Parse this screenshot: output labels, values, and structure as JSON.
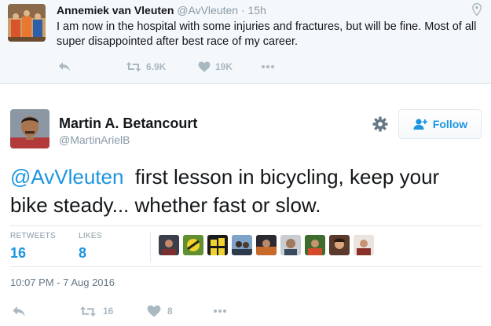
{
  "parent_tweet": {
    "name": "Annemiek van Vleuten",
    "handle": "@AvVleuten",
    "separator": "·",
    "time": "15h",
    "text": "I am now in the hospital with some injuries and fractures, but will be fine. Most of all super disappointed after best race of my career.",
    "retweets": "6.9K",
    "likes": "19K",
    "icons": [
      "reply-icon",
      "retweet-icon",
      "heart-icon",
      "more-icon",
      "location-pin-icon"
    ]
  },
  "main_tweet": {
    "name": "Martin A. Betancourt",
    "handle": "@MartinArielB",
    "follow_label": "Follow",
    "mention": "@AvVleuten",
    "text": "  first lesson in bicycling, keep your bike steady... whether fast or slow.",
    "stats": {
      "retweets_label": "RETWEETS",
      "retweets_value": "16",
      "likes_label": "LIKES",
      "likes_value": "8"
    },
    "likers_count_shown": 9,
    "timestamp": "10:07 PM - 7 Aug 2016",
    "action_retweets": "16",
    "action_likes": "8",
    "icons": [
      "gear-icon",
      "follow-user-icon",
      "reply-icon",
      "retweet-icon",
      "heart-icon",
      "more-icon"
    ]
  },
  "colors": {
    "accent": "#1b95e0",
    "muted": "#8899a6",
    "action_grey": "#aab8c2",
    "parent_bg": "#f5f8fa",
    "border": "#e1e8ed"
  }
}
